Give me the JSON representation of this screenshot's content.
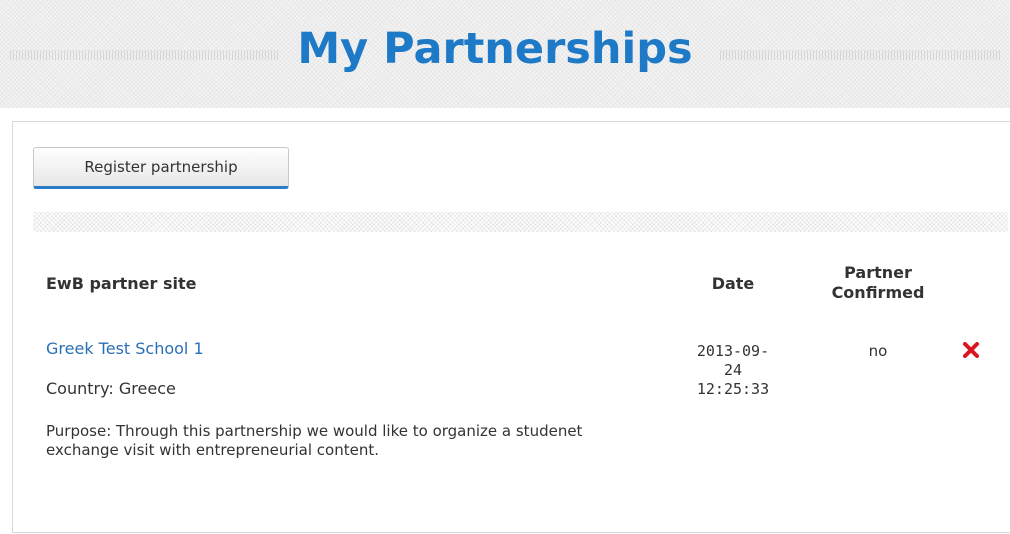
{
  "header": {
    "title": "My Partnerships"
  },
  "toolbar": {
    "register_label": "Register partnership"
  },
  "table": {
    "columns": {
      "site": "EwB partner site",
      "date": "Date",
      "confirmed_line1": "Partner",
      "confirmed_line2": "Confirmed"
    },
    "rows": [
      {
        "site_name": "Greek Test School 1",
        "country": "Country: Greece",
        "purpose": "Purpose: Through this partnership we would like to organize a studenet exchange visit with entrepreneurial content.",
        "date_line1": "2013-09-",
        "date_line2": "24",
        "date_line3": "12:25:33",
        "confirmed": "no",
        "delete_icon": "delete-x-icon"
      }
    ]
  },
  "colors": {
    "title": "#1e7ac6",
    "link": "#2a6fb5",
    "button_accent": "#2a7cc7",
    "delete": "#d9171e"
  }
}
